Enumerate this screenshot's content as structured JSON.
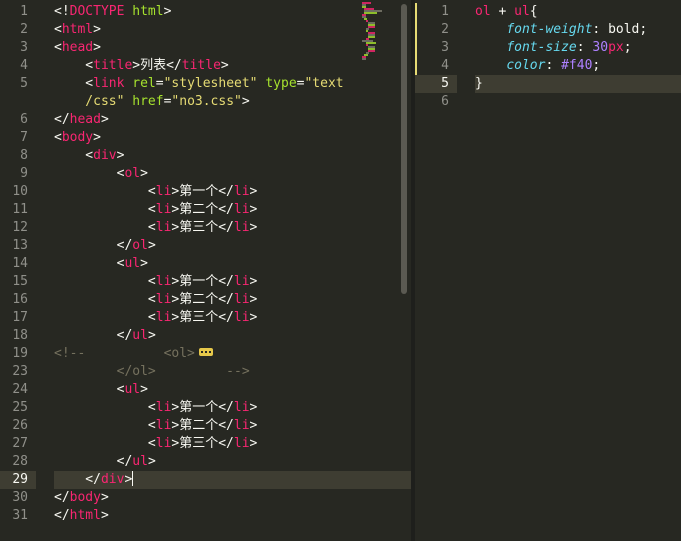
{
  "left_editor": {
    "line_numbers": [
      "1",
      "2",
      "3",
      "4",
      "5",
      "",
      "6",
      "7",
      "8",
      "9",
      "10",
      "11",
      "12",
      "13",
      "14",
      "15",
      "16",
      "17",
      "18",
      "19",
      "23",
      "24",
      "25",
      "26",
      "27",
      "28",
      "29",
      "30",
      "31"
    ],
    "active_line": "29",
    "lines": [
      [
        {
          "c": "p",
          "t": "<!"
        },
        {
          "c": "t",
          "t": "DOCTYPE"
        },
        {
          "c": "p",
          "t": " "
        },
        {
          "c": "a",
          "t": "html"
        },
        {
          "c": "p",
          "t": ">"
        }
      ],
      [
        {
          "c": "p",
          "t": "<"
        },
        {
          "c": "t",
          "t": "html"
        },
        {
          "c": "p",
          "t": ">"
        }
      ],
      [
        {
          "c": "p",
          "t": "<"
        },
        {
          "c": "t",
          "t": "head"
        },
        {
          "c": "p",
          "t": ">"
        }
      ],
      [
        {
          "c": "p",
          "t": "    <"
        },
        {
          "c": "t",
          "t": "title"
        },
        {
          "c": "p",
          "t": ">列表</"
        },
        {
          "c": "t",
          "t": "title"
        },
        {
          "c": "p",
          "t": ">"
        }
      ],
      [
        {
          "c": "p",
          "t": "    <"
        },
        {
          "c": "t",
          "t": "link"
        },
        {
          "c": "p",
          "t": " "
        },
        {
          "c": "a",
          "t": "rel"
        },
        {
          "c": "p",
          "t": "="
        },
        {
          "c": "s",
          "t": "\"stylesheet\""
        },
        {
          "c": "p",
          "t": " "
        },
        {
          "c": "a",
          "t": "type"
        },
        {
          "c": "p",
          "t": "="
        },
        {
          "c": "s",
          "t": "\"text"
        }
      ],
      [
        {
          "c": "s",
          "t": "    /css\""
        },
        {
          "c": "p",
          "t": " "
        },
        {
          "c": "a",
          "t": "href"
        },
        {
          "c": "p",
          "t": "="
        },
        {
          "c": "s",
          "t": "\"no3.css\""
        },
        {
          "c": "p",
          "t": ">"
        }
      ],
      [
        {
          "c": "p",
          "t": "</"
        },
        {
          "c": "t",
          "t": "head"
        },
        {
          "c": "p",
          "t": ">"
        }
      ],
      [
        {
          "c": "p",
          "t": "<"
        },
        {
          "c": "t",
          "t": "body"
        },
        {
          "c": "p",
          "t": ">"
        }
      ],
      [
        {
          "c": "p",
          "t": "    <"
        },
        {
          "c": "t",
          "t": "div"
        },
        {
          "c": "p",
          "t": ">"
        }
      ],
      [
        {
          "c": "p",
          "t": "        <"
        },
        {
          "c": "t",
          "t": "ol"
        },
        {
          "c": "p",
          "t": ">"
        }
      ],
      [
        {
          "c": "p",
          "t": "            <"
        },
        {
          "c": "t",
          "t": "li"
        },
        {
          "c": "p",
          "t": ">第一个</"
        },
        {
          "c": "t",
          "t": "li"
        },
        {
          "c": "p",
          "t": ">"
        }
      ],
      [
        {
          "c": "p",
          "t": "            <"
        },
        {
          "c": "t",
          "t": "li"
        },
        {
          "c": "p",
          "t": ">第二个</"
        },
        {
          "c": "t",
          "t": "li"
        },
        {
          "c": "p",
          "t": ">"
        }
      ],
      [
        {
          "c": "p",
          "t": "            <"
        },
        {
          "c": "t",
          "t": "li"
        },
        {
          "c": "p",
          "t": ">第三个</"
        },
        {
          "c": "t",
          "t": "li"
        },
        {
          "c": "p",
          "t": ">"
        }
      ],
      [
        {
          "c": "p",
          "t": "        </"
        },
        {
          "c": "t",
          "t": "ol"
        },
        {
          "c": "p",
          "t": ">"
        }
      ],
      [
        {
          "c": "p",
          "t": "        <"
        },
        {
          "c": "t",
          "t": "ul"
        },
        {
          "c": "p",
          "t": ">"
        }
      ],
      [
        {
          "c": "p",
          "t": "            <"
        },
        {
          "c": "t",
          "t": "li"
        },
        {
          "c": "p",
          "t": ">第一个</"
        },
        {
          "c": "t",
          "t": "li"
        },
        {
          "c": "p",
          "t": ">"
        }
      ],
      [
        {
          "c": "p",
          "t": "            <"
        },
        {
          "c": "t",
          "t": "li"
        },
        {
          "c": "p",
          "t": ">第二个</"
        },
        {
          "c": "t",
          "t": "li"
        },
        {
          "c": "p",
          "t": ">"
        }
      ],
      [
        {
          "c": "p",
          "t": "            <"
        },
        {
          "c": "t",
          "t": "li"
        },
        {
          "c": "p",
          "t": ">第三个</"
        },
        {
          "c": "t",
          "t": "li"
        },
        {
          "c": "p",
          "t": ">"
        }
      ],
      [
        {
          "c": "p",
          "t": "        </"
        },
        {
          "c": "t",
          "t": "ul"
        },
        {
          "c": "p",
          "t": ">"
        }
      ],
      [
        {
          "c": "c",
          "t": "<!--          <ol>"
        },
        {
          "c": "fold",
          "t": ""
        }
      ],
      [
        {
          "c": "c",
          "t": "        </ol>         -->"
        }
      ],
      [
        {
          "c": "p",
          "t": "        <"
        },
        {
          "c": "t",
          "t": "ul"
        },
        {
          "c": "p",
          "t": ">"
        }
      ],
      [
        {
          "c": "p",
          "t": "            <"
        },
        {
          "c": "t",
          "t": "li"
        },
        {
          "c": "p",
          "t": ">第一个</"
        },
        {
          "c": "t",
          "t": "li"
        },
        {
          "c": "p",
          "t": ">"
        }
      ],
      [
        {
          "c": "p",
          "t": "            <"
        },
        {
          "c": "t",
          "t": "li"
        },
        {
          "c": "p",
          "t": ">第二个</"
        },
        {
          "c": "t",
          "t": "li"
        },
        {
          "c": "p",
          "t": ">"
        }
      ],
      [
        {
          "c": "p",
          "t": "            <"
        },
        {
          "c": "t",
          "t": "li"
        },
        {
          "c": "p",
          "t": ">第三个</"
        },
        {
          "c": "t",
          "t": "li"
        },
        {
          "c": "p",
          "t": ">"
        }
      ],
      [
        {
          "c": "p",
          "t": "        </"
        },
        {
          "c": "t",
          "t": "ul"
        },
        {
          "c": "p",
          "t": ">"
        }
      ],
      [
        {
          "c": "p",
          "t": "    </"
        },
        {
          "c": "t",
          "t": "div"
        },
        {
          "c": "p",
          "t": ">"
        },
        {
          "c": "caret",
          "t": ""
        }
      ],
      [
        {
          "c": "p",
          "t": "</"
        },
        {
          "c": "t",
          "t": "body"
        },
        {
          "c": "p",
          "t": ">"
        }
      ],
      [
        {
          "c": "p",
          "t": "</"
        },
        {
          "c": "t",
          "t": "html"
        },
        {
          "c": "p",
          "t": ">"
        }
      ]
    ]
  },
  "right_editor": {
    "line_numbers": [
      "1",
      "2",
      "3",
      "4",
      "5",
      "6"
    ],
    "active_line": "5",
    "lines": [
      [
        {
          "c": "t",
          "t": "ol"
        },
        {
          "c": "p",
          "t": " + "
        },
        {
          "c": "t",
          "t": "ul"
        },
        {
          "c": "p",
          "t": "{"
        }
      ],
      [
        {
          "c": "p",
          "t": "    "
        },
        {
          "c": "k",
          "t": "font-weight"
        },
        {
          "c": "p",
          "t": ": "
        },
        {
          "c": "p",
          "t": "bold;"
        }
      ],
      [
        {
          "c": "p",
          "t": "    "
        },
        {
          "c": "k",
          "t": "font-size"
        },
        {
          "c": "p",
          "t": ": "
        },
        {
          "c": "n",
          "t": "30"
        },
        {
          "c": "u",
          "t": "px"
        },
        {
          "c": "p",
          "t": ";"
        }
      ],
      [
        {
          "c": "p",
          "t": "    "
        },
        {
          "c": "k",
          "t": "color"
        },
        {
          "c": "p",
          "t": ": "
        },
        {
          "c": "n",
          "t": "#f40"
        },
        {
          "c": "p",
          "t": ";"
        }
      ],
      [
        {
          "c": "p",
          "t": "}"
        }
      ],
      []
    ]
  },
  "colors": {
    "background": "#272822",
    "tag": "#f92672",
    "attribute": "#a6e22e",
    "string": "#e6db74",
    "comment": "#75715e",
    "property": "#66d9ef",
    "number": "#ae81ff"
  }
}
